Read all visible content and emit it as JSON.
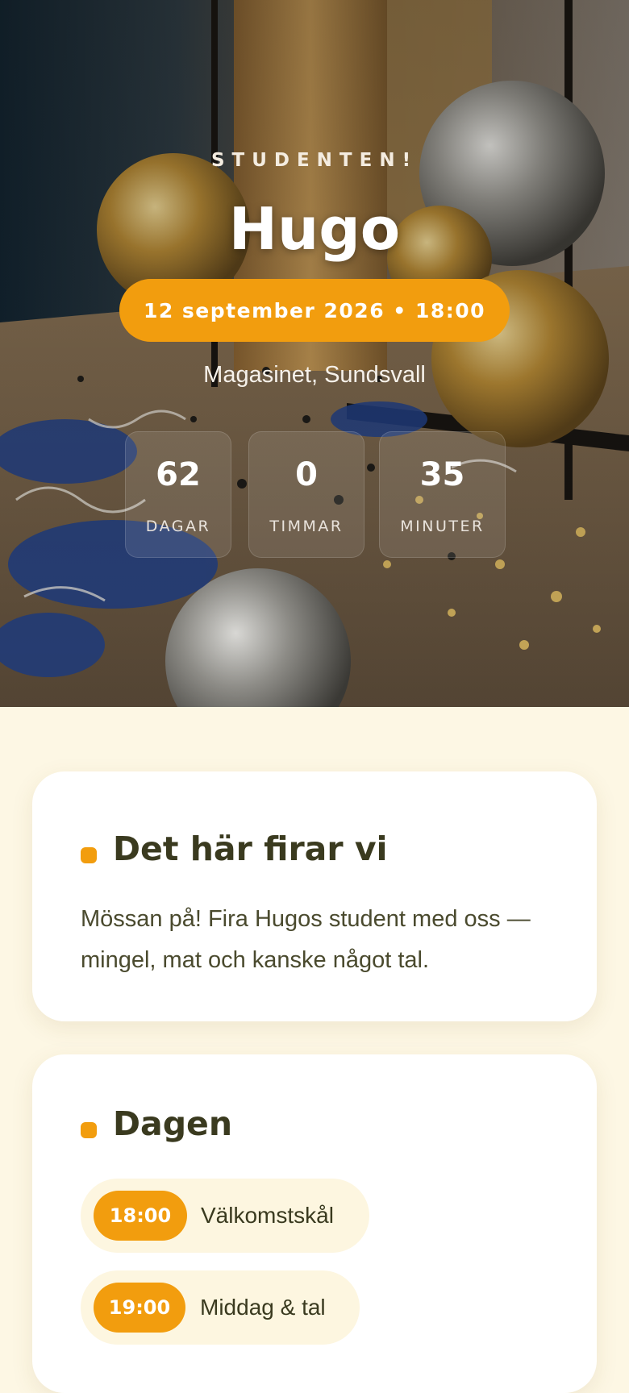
{
  "hero": {
    "kicker": "STUDENTEN!",
    "name": "Hugo",
    "date_time": "12 september 2026 • 18:00",
    "venue": "Magasinet, Sundsvall",
    "background": "party-confetti-balloons-photo"
  },
  "countdown": [
    {
      "value": "62",
      "label": "DAGAR"
    },
    {
      "value": "0",
      "label": "TIMMAR"
    },
    {
      "value": "35",
      "label": "MINUTER"
    }
  ],
  "about": {
    "title": "Det här firar vi",
    "text": "Mössan på! Fira Hugos student med oss — mingel, mat och kanske något tal."
  },
  "schedule": {
    "title": "Dagen",
    "items": [
      {
        "time": "18:00",
        "label": "Välkomstskål"
      },
      {
        "time": "19:00",
        "label": "Middag & tal"
      }
    ]
  },
  "colors": {
    "accent": "#f29d0e",
    "page_background": "#fdf7e4",
    "heading": "#3a3a1f",
    "card": "#ffffff"
  }
}
